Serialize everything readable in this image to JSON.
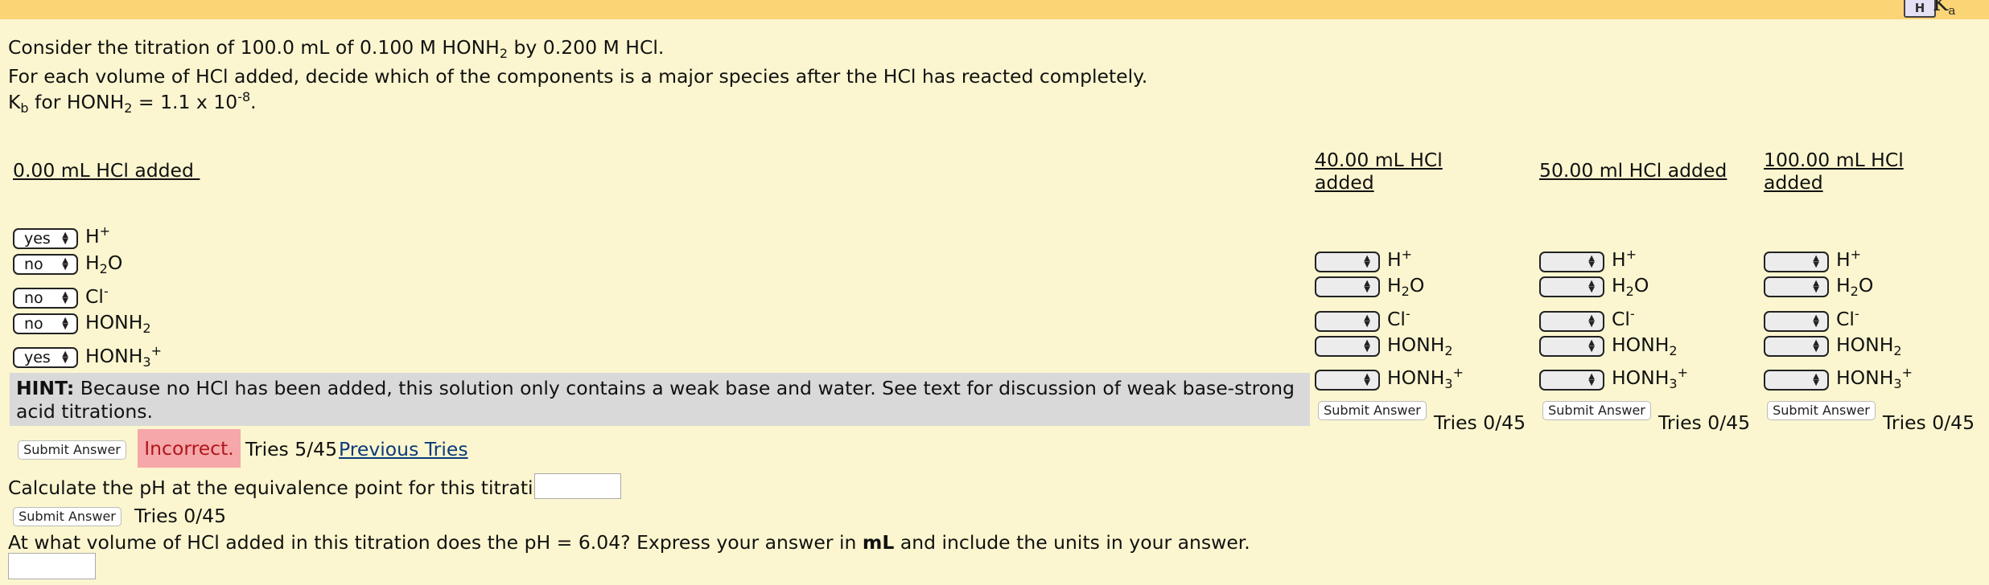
{
  "toolbar": {
    "ka_icon": "H",
    "ka_label_main": "K",
    "ka_label_sub": "a"
  },
  "problem": {
    "line1": {
      "pre": "Consider the titration of 100.0 mL of 0.100 M HONH",
      "sub": "2",
      "post": " by 0.200 M HCl."
    },
    "line2": "For each volume of HCl added, decide which of the components is a major species after the HCl has reacted completely.",
    "line3": {
      "k": "K",
      "ksub": "b",
      "mid": " for HONH",
      "sub2": "2",
      "eq": " = 1.1 x 10",
      "exp": "-8",
      "end": "."
    }
  },
  "columns": [
    {
      "heading": "0.00 mL HCl added ",
      "selects": [
        "yes",
        "no",
        "no",
        "no",
        "yes"
      ]
    },
    {
      "heading_line1": "40.00 mL HCl",
      "heading_line2": "added",
      "selects": [
        "",
        "",
        "",
        "",
        ""
      ],
      "tries": "Tries 0/45"
    },
    {
      "heading": "50.00 ml HCl added",
      "selects": [
        "",
        "",
        "",
        "",
        ""
      ],
      "tries": "Tries 0/45"
    },
    {
      "heading_line1": "100.00 mL HCl",
      "heading_line2": "added",
      "selects": [
        "",
        "",
        "",
        "",
        ""
      ],
      "tries": "Tries 0/45"
    }
  ],
  "species": {
    "h": "H",
    "h_sup": "+",
    "water_a": "H",
    "water_sub": "2",
    "water_b": "O",
    "cl": "Cl",
    "cl_sup": "-",
    "base_a": "HONH",
    "base_sub": "2",
    "acid_a": "HONH",
    "acid_sub": "3",
    "acid_sup": "+"
  },
  "hint": {
    "bold": "HINT:",
    "text": " Because no HCl has been added, this solution only contains a weak base and water. See text for discussion of weak base-strong acid titrations."
  },
  "submit_label": "Submit Answer",
  "feedback": {
    "status": "Incorrect.",
    "tries": "Tries 5/45",
    "previous_tries": "Previous Tries"
  },
  "q2": {
    "text": "Calculate the pH at the equivalence point for this titration.",
    "input_value": "",
    "tries": "Tries 0/45"
  },
  "q3": {
    "pre": "At what volume of HCl added in this titration does the pH = 6.04? Express your answer in ",
    "bold": "mL",
    "post": " and include the units in your answer.",
    "input_value": ""
  },
  "colors": {
    "topbar": "#fbd476",
    "background": "#fbf6cf",
    "hint_bg": "#d9d9d9",
    "incorrect_bg": "#f6a7a9",
    "incorrect_text": "#b0161d",
    "link": "#0a3a7a"
  }
}
